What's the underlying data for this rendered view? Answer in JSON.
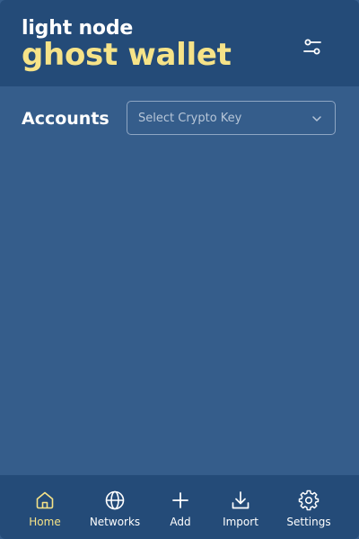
{
  "header": {
    "subtitle": "light node",
    "title": "ghost wallet"
  },
  "accounts": {
    "label": "Accounts",
    "select_placeholder": "Select Crypto Key"
  },
  "nav": {
    "items": [
      {
        "label": "Home",
        "icon": "home-icon",
        "active": true
      },
      {
        "label": "Networks",
        "icon": "globe-icon",
        "active": false
      },
      {
        "label": "Add",
        "icon": "plus-icon",
        "active": false
      },
      {
        "label": "Import",
        "icon": "download-icon",
        "active": false
      },
      {
        "label": "Settings",
        "icon": "gear-icon",
        "active": false
      }
    ]
  },
  "colors": {
    "header_bg": "#244b78",
    "body_bg": "#355d8b",
    "accent": "#f6e388"
  }
}
